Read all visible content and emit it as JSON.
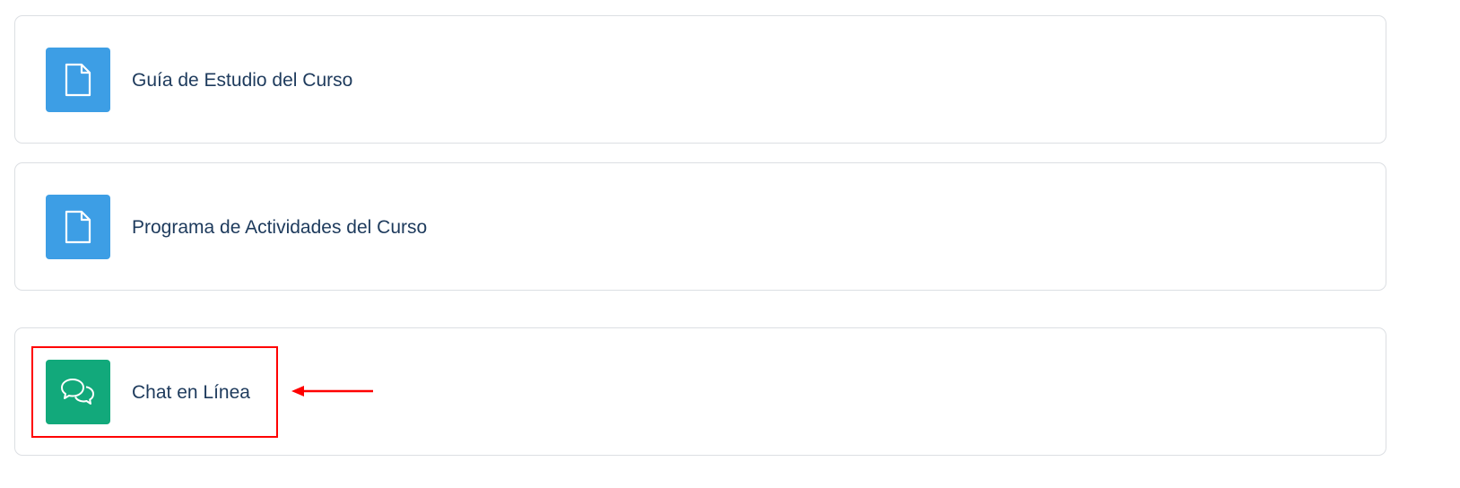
{
  "activities": [
    {
      "label": "Guía de Estudio del Curso",
      "icon": "file-icon",
      "color": "#3d9ee5"
    },
    {
      "label": "Programa de Actividades del Curso",
      "icon": "file-icon",
      "color": "#3d9ee5"
    },
    {
      "label": "Chat en Línea",
      "icon": "chat-icon",
      "color": "#12a97b"
    }
  ],
  "annotation": {
    "color": "#ff0000",
    "target": "Chat en Línea"
  }
}
